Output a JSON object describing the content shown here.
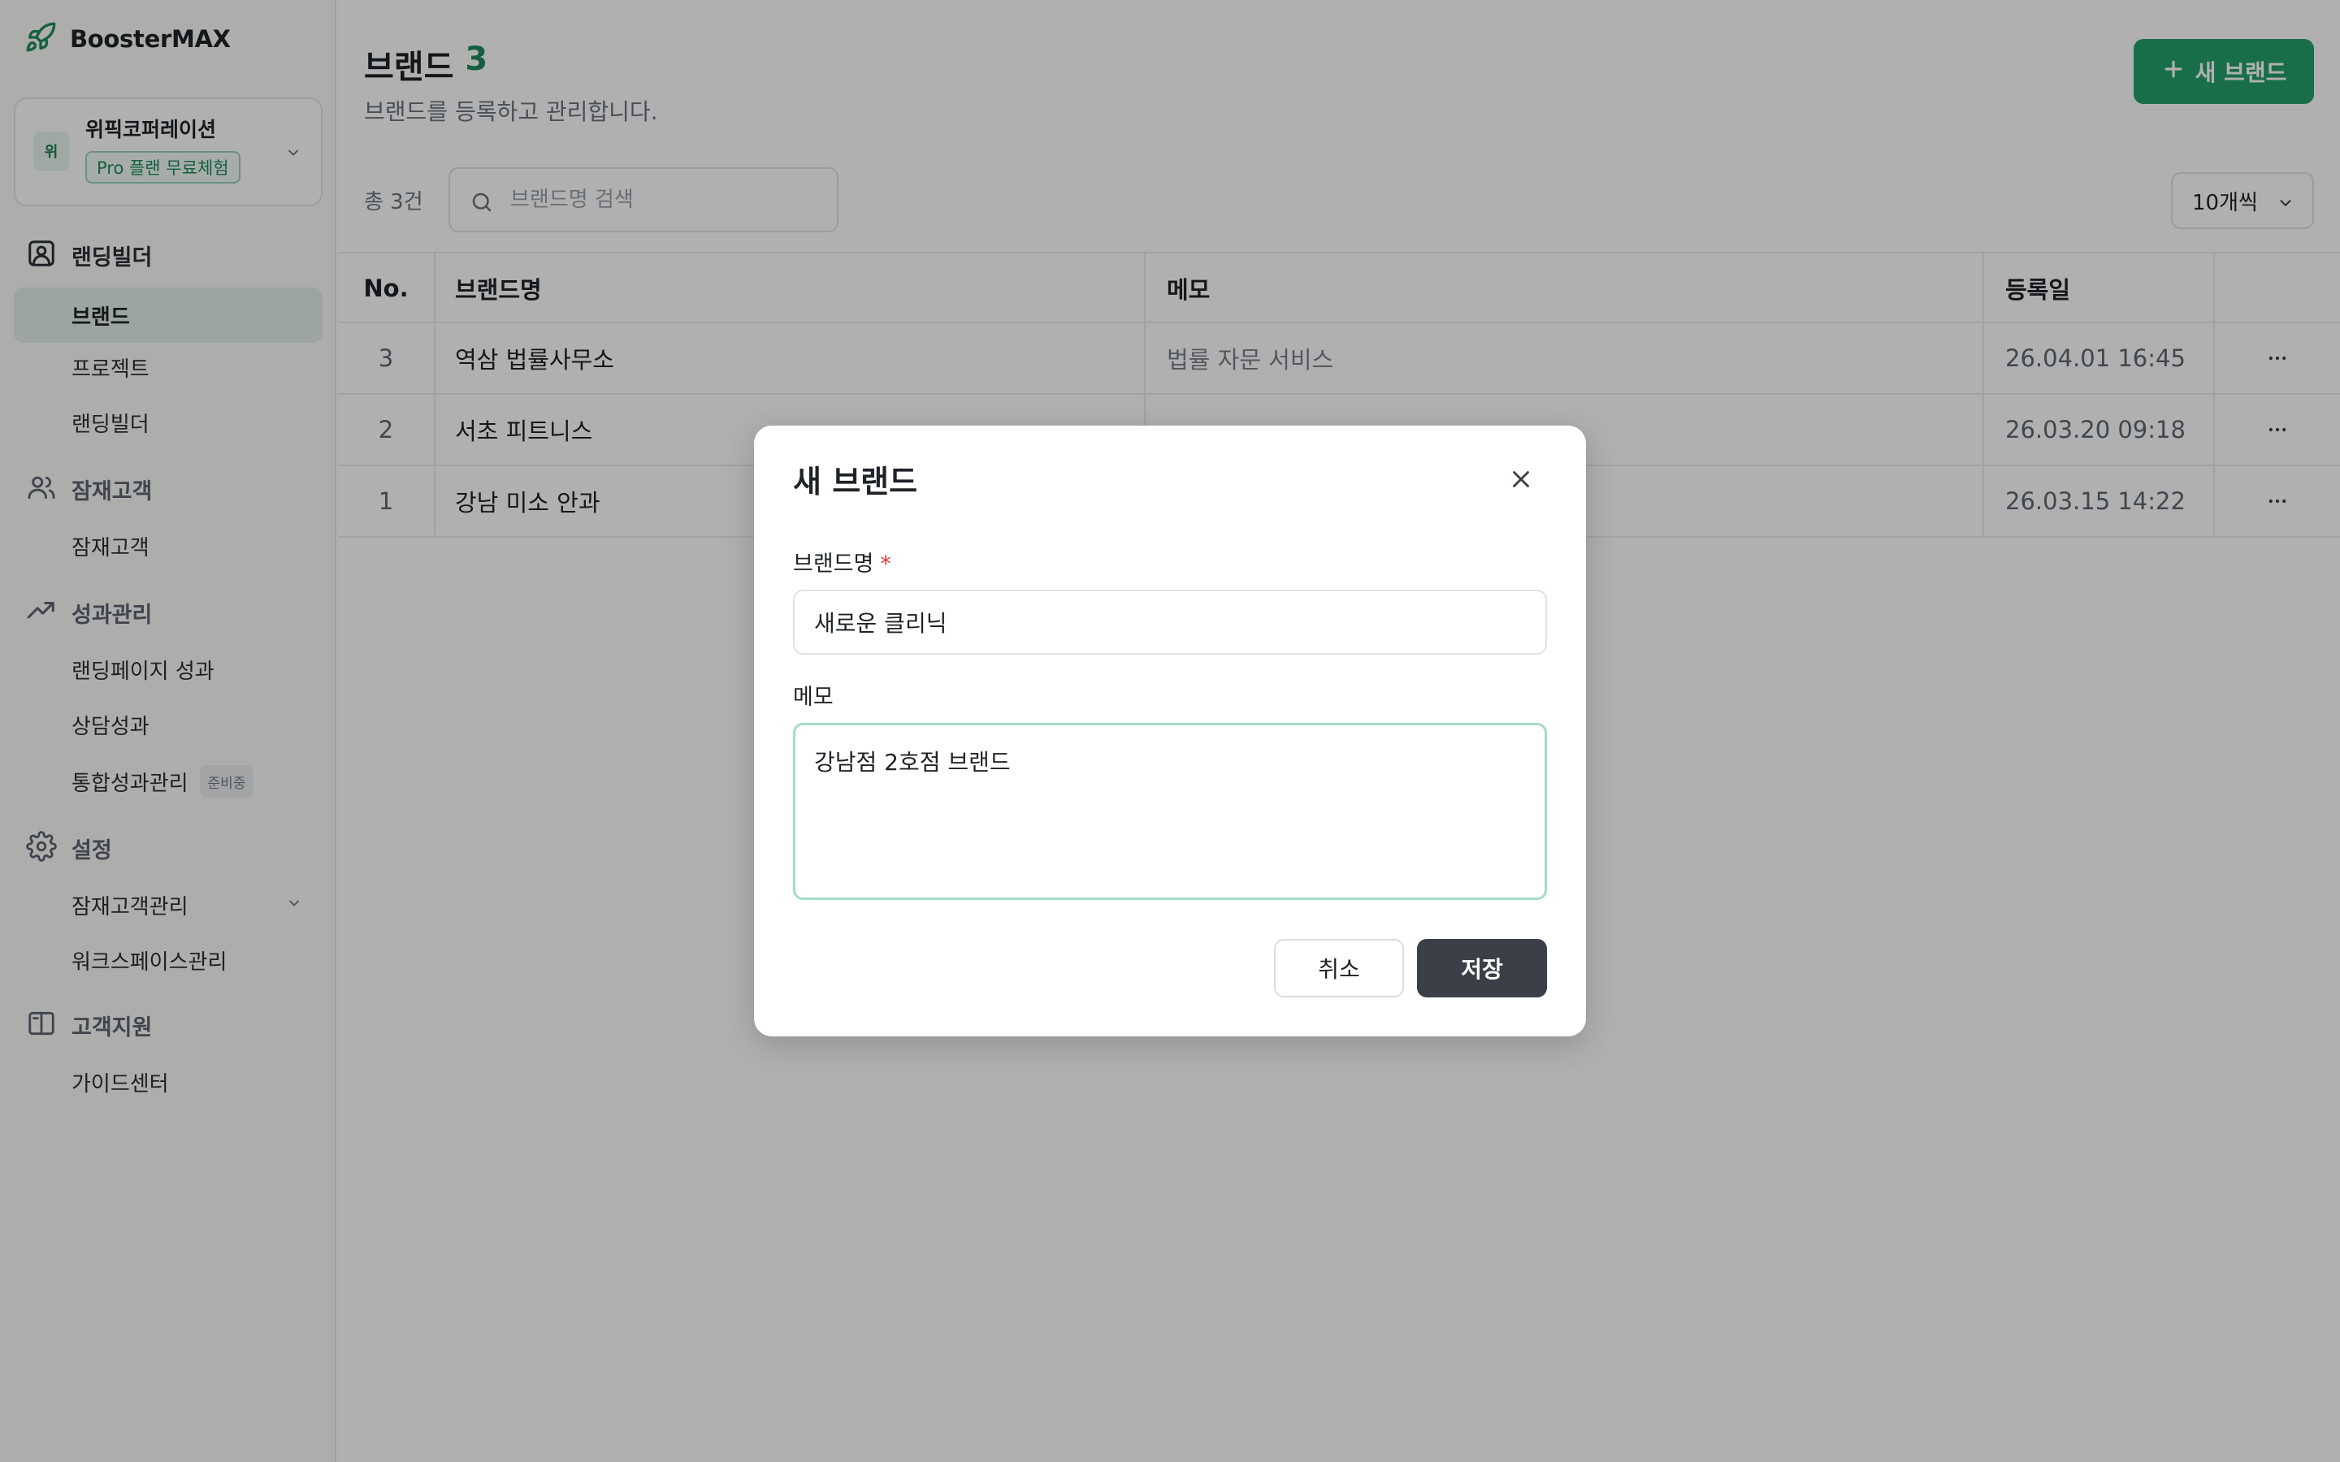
{
  "app": {
    "name": "BoosterMAX"
  },
  "workspace": {
    "avatar": "위",
    "name": "위픽코퍼레이션",
    "plan": "Pro 플랜 무료체험"
  },
  "sidebar": {
    "sections": [
      {
        "label": "랜딩빌더",
        "icon": "image-icon",
        "items": [
          "브랜드",
          "프로젝트",
          "랜딩빌더"
        ]
      },
      {
        "label": "잠재고객",
        "icon": "users-icon",
        "items": [
          "잠재고객"
        ]
      },
      {
        "label": "성과관리",
        "icon": "trend-up-icon",
        "items": [
          "랜딩페이지 성과",
          "상담성과",
          "통합성과관리"
        ]
      },
      {
        "label": "설정",
        "icon": "gear-icon",
        "items": [
          "잠재고객관리",
          "워크스페이스관리"
        ]
      },
      {
        "label": "고객지원",
        "icon": "book-icon",
        "items": [
          "가이드센터"
        ]
      }
    ],
    "active_item": "브랜드",
    "soon_badge": "준비중"
  },
  "page": {
    "title": "브랜드",
    "title_count": "3",
    "subtitle": "브랜드를 등록하고 관리합니다.",
    "new_button": "새 브랜드",
    "total": "총 3건",
    "search_placeholder": "브랜드명 검색",
    "per_page": "10개씩"
  },
  "table": {
    "headers": {
      "no": "No.",
      "name": "브랜드명",
      "memo": "메모",
      "date": "등록일"
    },
    "rows": [
      {
        "no": "3",
        "name": "역삼 법률사무소",
        "memo": "법률 자문 서비스",
        "date": "26.04.01 16:45"
      },
      {
        "no": "2",
        "name": "서초 피트니스",
        "memo": "",
        "date": "26.03.20 09:18"
      },
      {
        "no": "1",
        "name": "강남 미소 안과",
        "memo": "",
        "date": "26.03.15 14:22"
      }
    ]
  },
  "modal": {
    "title": "새 브랜드",
    "name_label": "브랜드명",
    "required_mark": "*",
    "name_value": "새로운 클리닉",
    "memo_label": "메모",
    "memo_value": "강남점 2호점 브랜드",
    "cancel": "취소",
    "save": "저장"
  },
  "colors": {
    "accent": "#24a06b",
    "save_button": "#3a3f48",
    "required": "#e5393b"
  }
}
